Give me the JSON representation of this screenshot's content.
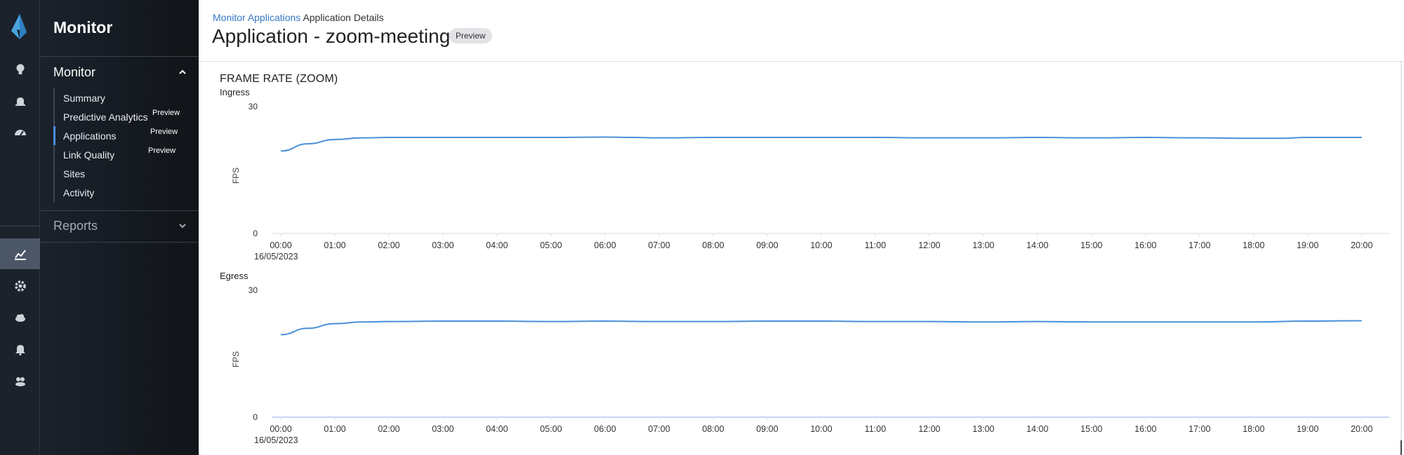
{
  "sidebar": {
    "title": "Monitor",
    "sections": [
      {
        "label": "Monitor",
        "expanded": true
      },
      {
        "label": "Reports",
        "expanded": false
      }
    ],
    "items": [
      {
        "label": "Summary",
        "badge": ""
      },
      {
        "label": "Predictive Analytics",
        "badge": "Preview"
      },
      {
        "label": "Applications",
        "badge": "Preview",
        "active": true
      },
      {
        "label": "Link Quality",
        "badge": "Preview"
      },
      {
        "label": "Sites",
        "badge": ""
      },
      {
        "label": "Activity",
        "badge": ""
      }
    ]
  },
  "rail": {
    "icons": [
      "logo-icon",
      "lightbulb-icon",
      "alarm-icon",
      "dashboard-gauge-icon",
      "analytics-chart-icon",
      "gear-icon",
      "cloud-icon",
      "bell-icon",
      "users-icon"
    ],
    "active": "analytics-chart-icon"
  },
  "header": {
    "breadcrumb_link_1": "Monitor",
    "breadcrumb_link_2": "Applications",
    "breadcrumb_current": "Application Details",
    "title": "Application - zoom-meeting",
    "badge": "Preview"
  },
  "panel": {
    "title": "FRAME RATE (ZOOM)"
  },
  "colors": {
    "line": "#4a90d9",
    "accent": "#4a90e2"
  },
  "chart_data": [
    {
      "type": "line",
      "title": "Ingress",
      "ylabel": "FPS",
      "ylim": [
        0,
        30
      ],
      "yticks": [
        "30",
        "0"
      ],
      "x_ticks": [
        "00:00",
        "01:00",
        "02:00",
        "03:00",
        "04:00",
        "05:00",
        "06:00",
        "07:00",
        "08:00",
        "09:00",
        "10:00",
        "11:00",
        "12:00",
        "13:00",
        "14:00",
        "15:00",
        "16:00",
        "17:00",
        "18:00",
        "19:00",
        "20:00"
      ],
      "x_date": "16/05/2023",
      "x_range_hours": [
        0,
        20.25
      ],
      "series": [
        {
          "x": [
            0,
            0.5,
            1,
            1.5,
            2,
            3,
            4,
            5,
            6,
            6.5,
            7,
            8,
            9,
            10,
            11,
            12,
            13,
            14,
            15,
            16,
            17,
            18,
            18.5,
            19,
            20
          ],
          "values": [
            19.5,
            21.2,
            22.2,
            22.6,
            22.7,
            22.7,
            22.7,
            22.7,
            22.8,
            22.7,
            22.6,
            22.7,
            22.7,
            22.7,
            22.7,
            22.6,
            22.6,
            22.7,
            22.6,
            22.7,
            22.6,
            22.5,
            22.5,
            22.7,
            22.7
          ]
        }
      ]
    },
    {
      "type": "line",
      "title": "Egress",
      "ylabel": "FPS",
      "ylim": [
        0,
        30
      ],
      "yticks": [
        "30",
        "0"
      ],
      "x_ticks": [
        "00:00",
        "01:00",
        "02:00",
        "03:00",
        "04:00",
        "05:00",
        "06:00",
        "07:00",
        "08:00",
        "09:00",
        "10:00",
        "11:00",
        "12:00",
        "13:00",
        "14:00",
        "15:00",
        "16:00",
        "17:00",
        "18:00",
        "19:00",
        "20:00"
      ],
      "x_date": "16/05/2023",
      "x_range_hours": [
        0,
        20.25
      ],
      "series": [
        {
          "x": [
            0,
            0.5,
            1,
            1.5,
            2,
            3,
            4,
            5,
            6,
            7,
            8,
            9,
            10,
            11,
            12,
            13,
            14,
            15,
            16,
            17,
            18,
            19,
            20
          ],
          "values": [
            19.5,
            21.0,
            22.1,
            22.5,
            22.6,
            22.7,
            22.7,
            22.6,
            22.7,
            22.6,
            22.6,
            22.7,
            22.7,
            22.6,
            22.6,
            22.5,
            22.6,
            22.5,
            22.5,
            22.5,
            22.5,
            22.7,
            22.8
          ]
        }
      ]
    }
  ]
}
